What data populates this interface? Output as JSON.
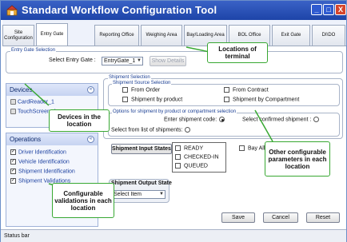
{
  "window": {
    "title": "Standard Workflow Configuration Tool",
    "controls": {
      "minimize": "_",
      "maximize": "□",
      "close": "X"
    }
  },
  "tabs": [
    {
      "label": "Site Configuration"
    },
    {
      "label": "Entry Gate"
    },
    {
      "label": "Reporting Office"
    },
    {
      "label": "Weighing Area"
    },
    {
      "label": "Bay/Loading Area"
    },
    {
      "label": "BOL Office"
    },
    {
      "label": "Exit Gate"
    },
    {
      "label": "DI\\DO"
    }
  ],
  "entry_gate_selection": {
    "group_label": "Entry Gate Selection",
    "select_label": "Select Entry Gate :",
    "select_value": "EntryGate_1",
    "show_details": "Show Details"
  },
  "devices": {
    "title": "Devices",
    "collapse": "«",
    "items": [
      "CardReader_1",
      "TouchScreen_1"
    ]
  },
  "operations": {
    "title": "Operations",
    "collapse": "«",
    "items": [
      {
        "label": "Driver Identification",
        "checked": true
      },
      {
        "label": "Vehicle Identification",
        "checked": true
      },
      {
        "label": "Shipment Identification",
        "checked": true
      },
      {
        "label": "Shipment Validations",
        "checked": true
      }
    ]
  },
  "shipment_selection": {
    "group_label": "Shipment Selection",
    "source_label": "Shipment Source Selection",
    "sources": [
      "From Order",
      "From Contract",
      "Shipment by product",
      "Shipment by Compartment"
    ],
    "options_label": "Options for shipment by product or compartment selection",
    "enter_code": "Enter shipment code:",
    "select_confirmed": "Select confirmed shipment :",
    "select_from_list": "Select from list of shipments:"
  },
  "shipment_input_states": {
    "button": "Shipment Input States",
    "states": [
      "READY",
      "CHECKED-IN",
      "QUEUED"
    ]
  },
  "bay_allocation": "Bay Allocation Required",
  "shipment_output_state": {
    "label": "Shipment Output State",
    "value": "Select Item"
  },
  "actions": {
    "save": "Save",
    "cancel": "Cancel",
    "reset": "Reset"
  },
  "status_bar": "Status bar",
  "callouts": {
    "locations": "Locations of terminal",
    "devices": "Devices in the location",
    "other": "Other configurable parameters in each location",
    "validations": "Configurable validations in each location"
  },
  "colors": {
    "titlebar": "#1d44a8",
    "callout_border": "#38a832",
    "link_text": "#1a3fa0"
  }
}
